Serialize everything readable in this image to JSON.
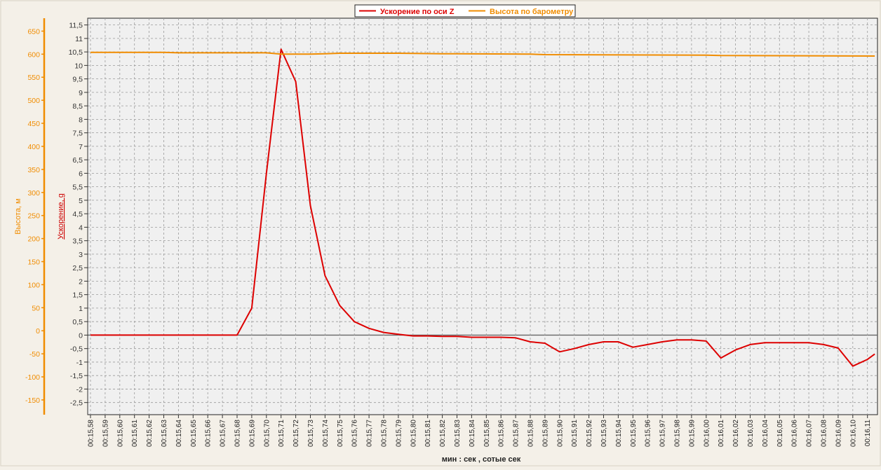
{
  "chart_data": {
    "type": "line",
    "xlabel": "мин : сек , сотые сек",
    "x": [
      "00:15,58",
      "00:15,59",
      "00:15,60",
      "00:15,61",
      "00:15,62",
      "00:15,63",
      "00:15,64",
      "00:15,65",
      "00:15,66",
      "00:15,67",
      "00:15,68",
      "00:15,69",
      "00:15,70",
      "00:15,71",
      "00:15,72",
      "00:15,73",
      "00:15,74",
      "00:15,75",
      "00:15,76",
      "00:15,77",
      "00:15,78",
      "00:15,79",
      "00:15,80",
      "00:15,81",
      "00:15,82",
      "00:15,83",
      "00:15,84",
      "00:15,85",
      "00:15,86",
      "00:15,87",
      "00:15,88",
      "00:15,89",
      "00:15,90",
      "00:15,91",
      "00:15,92",
      "00:15,93",
      "00:15,94",
      "00:15,95",
      "00:15,96",
      "00:15,97",
      "00:15,98",
      "00:15,99",
      "00:16,00",
      "00:16,01",
      "00:16,02",
      "00:16,03",
      "00:16,04",
      "00:16,05",
      "00:16,06",
      "00:16,07",
      "00:16,08",
      "00:16,09",
      "00:16,10",
      "00:16,11"
    ],
    "left_axis": {
      "label": "Высота, м",
      "ticks": [
        "650",
        "600",
        "550",
        "500",
        "450",
        "400",
        "350",
        "300",
        "250",
        "200",
        "150",
        "100",
        "50",
        "0",
        "-50",
        "-100",
        "-150"
      ],
      "range": [
        -182,
        678
      ],
      "color": "#f08c00"
    },
    "right_axis": {
      "label": "Ускорение, g",
      "ticks": [
        "11,5",
        "11",
        "10,5",
        "10",
        "9,5",
        "9",
        "8,5",
        "8",
        "7,5",
        "7",
        "6,5",
        "6",
        "5,5",
        "5",
        "4,5",
        "4",
        "3,5",
        "3",
        "2,5",
        "2",
        "1,5",
        "1",
        "0,5",
        "0",
        "-0,5",
        "-1",
        "-1,5",
        "-2",
        "-2,5"
      ],
      "range": [
        -2.95,
        11.75
      ],
      "color": "#cc0000"
    },
    "series": [
      {
        "name": "Ускорение по оси Z",
        "color": "#dd0000",
        "axis": "right",
        "x_index": [
          0,
          1,
          2,
          3,
          4,
          5,
          6,
          7,
          8,
          9,
          10,
          11,
          12,
          13,
          14,
          15,
          16,
          17,
          18,
          19,
          20,
          21,
          22,
          23,
          24,
          25,
          26,
          27,
          28,
          29,
          30,
          31,
          32,
          33,
          34,
          35,
          36,
          37,
          38,
          39,
          40,
          41,
          42,
          43,
          44,
          45,
          46,
          47,
          48,
          49,
          50,
          51,
          52,
          53,
          53.5
        ],
        "values": [
          0,
          0,
          0,
          0,
          0,
          0,
          0,
          0,
          0,
          0,
          0,
          1,
          6,
          10.6,
          9.4,
          4.8,
          2.2,
          1.1,
          0.5,
          0.25,
          0.1,
          0.03,
          -0.03,
          -0.03,
          -0.05,
          -0.05,
          -0.08,
          -0.08,
          -0.08,
          -0.1,
          -0.25,
          -0.3,
          -0.62,
          -0.5,
          -0.35,
          -0.25,
          -0.25,
          -0.45,
          -0.35,
          -0.25,
          -0.18,
          -0.18,
          -0.22,
          -0.85,
          -0.55,
          -0.35,
          -0.28,
          -0.28,
          -0.28,
          -0.28,
          -0.35,
          -0.48,
          -1.15,
          -0.9,
          -0.7
        ]
      },
      {
        "name": "Высота по барометру",
        "color": "#f08c00",
        "axis": "left",
        "x_index": [
          0,
          5,
          6,
          12,
          13,
          15,
          16,
          17,
          20,
          21,
          24,
          25,
          30,
          31,
          42,
          43,
          53.5
        ],
        "values": [
          604,
          604,
          603,
          603,
          600,
          600,
          601,
          602,
          602,
          602,
          601,
          601,
          600,
          599,
          598,
          597,
          596
        ]
      }
    ],
    "grid": true,
    "legend": "top-center",
    "zero_line": true
  }
}
